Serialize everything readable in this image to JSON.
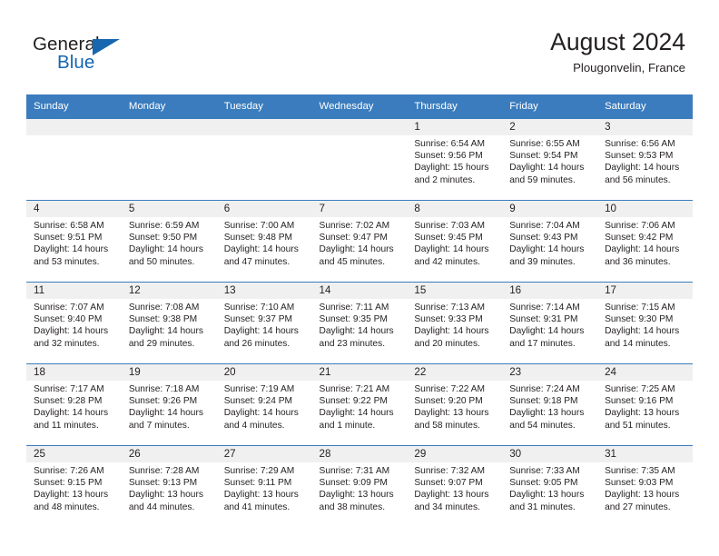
{
  "brand": {
    "name_top": "General",
    "name_bottom": "Blue",
    "triangle_color": "#1666b0",
    "text_color": "#231f20"
  },
  "header": {
    "title": "August 2024",
    "location": "Plougonvelin, France"
  },
  "theme": {
    "header_blue": "#3a7cbe",
    "daynum_strip": "#f0f0f0",
    "text": "#231f20"
  },
  "weekdays": [
    "Sunday",
    "Monday",
    "Tuesday",
    "Wednesday",
    "Thursday",
    "Friday",
    "Saturday"
  ],
  "weeks": [
    [
      {
        "day": ""
      },
      {
        "day": ""
      },
      {
        "day": ""
      },
      {
        "day": ""
      },
      {
        "day": "1",
        "sunrise": "Sunrise: 6:54 AM",
        "sunset": "Sunset: 9:56 PM",
        "daylight_1": "Daylight: 15 hours",
        "daylight_2": "and 2 minutes."
      },
      {
        "day": "2",
        "sunrise": "Sunrise: 6:55 AM",
        "sunset": "Sunset: 9:54 PM",
        "daylight_1": "Daylight: 14 hours",
        "daylight_2": "and 59 minutes."
      },
      {
        "day": "3",
        "sunrise": "Sunrise: 6:56 AM",
        "sunset": "Sunset: 9:53 PM",
        "daylight_1": "Daylight: 14 hours",
        "daylight_2": "and 56 minutes."
      }
    ],
    [
      {
        "day": "4",
        "sunrise": "Sunrise: 6:58 AM",
        "sunset": "Sunset: 9:51 PM",
        "daylight_1": "Daylight: 14 hours",
        "daylight_2": "and 53 minutes."
      },
      {
        "day": "5",
        "sunrise": "Sunrise: 6:59 AM",
        "sunset": "Sunset: 9:50 PM",
        "daylight_1": "Daylight: 14 hours",
        "daylight_2": "and 50 minutes."
      },
      {
        "day": "6",
        "sunrise": "Sunrise: 7:00 AM",
        "sunset": "Sunset: 9:48 PM",
        "daylight_1": "Daylight: 14 hours",
        "daylight_2": "and 47 minutes."
      },
      {
        "day": "7",
        "sunrise": "Sunrise: 7:02 AM",
        "sunset": "Sunset: 9:47 PM",
        "daylight_1": "Daylight: 14 hours",
        "daylight_2": "and 45 minutes."
      },
      {
        "day": "8",
        "sunrise": "Sunrise: 7:03 AM",
        "sunset": "Sunset: 9:45 PM",
        "daylight_1": "Daylight: 14 hours",
        "daylight_2": "and 42 minutes."
      },
      {
        "day": "9",
        "sunrise": "Sunrise: 7:04 AM",
        "sunset": "Sunset: 9:43 PM",
        "daylight_1": "Daylight: 14 hours",
        "daylight_2": "and 39 minutes."
      },
      {
        "day": "10",
        "sunrise": "Sunrise: 7:06 AM",
        "sunset": "Sunset: 9:42 PM",
        "daylight_1": "Daylight: 14 hours",
        "daylight_2": "and 36 minutes."
      }
    ],
    [
      {
        "day": "11",
        "sunrise": "Sunrise: 7:07 AM",
        "sunset": "Sunset: 9:40 PM",
        "daylight_1": "Daylight: 14 hours",
        "daylight_2": "and 32 minutes."
      },
      {
        "day": "12",
        "sunrise": "Sunrise: 7:08 AM",
        "sunset": "Sunset: 9:38 PM",
        "daylight_1": "Daylight: 14 hours",
        "daylight_2": "and 29 minutes."
      },
      {
        "day": "13",
        "sunrise": "Sunrise: 7:10 AM",
        "sunset": "Sunset: 9:37 PM",
        "daylight_1": "Daylight: 14 hours",
        "daylight_2": "and 26 minutes."
      },
      {
        "day": "14",
        "sunrise": "Sunrise: 7:11 AM",
        "sunset": "Sunset: 9:35 PM",
        "daylight_1": "Daylight: 14 hours",
        "daylight_2": "and 23 minutes."
      },
      {
        "day": "15",
        "sunrise": "Sunrise: 7:13 AM",
        "sunset": "Sunset: 9:33 PM",
        "daylight_1": "Daylight: 14 hours",
        "daylight_2": "and 20 minutes."
      },
      {
        "day": "16",
        "sunrise": "Sunrise: 7:14 AM",
        "sunset": "Sunset: 9:31 PM",
        "daylight_1": "Daylight: 14 hours",
        "daylight_2": "and 17 minutes."
      },
      {
        "day": "17",
        "sunrise": "Sunrise: 7:15 AM",
        "sunset": "Sunset: 9:30 PM",
        "daylight_1": "Daylight: 14 hours",
        "daylight_2": "and 14 minutes."
      }
    ],
    [
      {
        "day": "18",
        "sunrise": "Sunrise: 7:17 AM",
        "sunset": "Sunset: 9:28 PM",
        "daylight_1": "Daylight: 14 hours",
        "daylight_2": "and 11 minutes."
      },
      {
        "day": "19",
        "sunrise": "Sunrise: 7:18 AM",
        "sunset": "Sunset: 9:26 PM",
        "daylight_1": "Daylight: 14 hours",
        "daylight_2": "and 7 minutes."
      },
      {
        "day": "20",
        "sunrise": "Sunrise: 7:19 AM",
        "sunset": "Sunset: 9:24 PM",
        "daylight_1": "Daylight: 14 hours",
        "daylight_2": "and 4 minutes."
      },
      {
        "day": "21",
        "sunrise": "Sunrise: 7:21 AM",
        "sunset": "Sunset: 9:22 PM",
        "daylight_1": "Daylight: 14 hours",
        "daylight_2": "and 1 minute."
      },
      {
        "day": "22",
        "sunrise": "Sunrise: 7:22 AM",
        "sunset": "Sunset: 9:20 PM",
        "daylight_1": "Daylight: 13 hours",
        "daylight_2": "and 58 minutes."
      },
      {
        "day": "23",
        "sunrise": "Sunrise: 7:24 AM",
        "sunset": "Sunset: 9:18 PM",
        "daylight_1": "Daylight: 13 hours",
        "daylight_2": "and 54 minutes."
      },
      {
        "day": "24",
        "sunrise": "Sunrise: 7:25 AM",
        "sunset": "Sunset: 9:16 PM",
        "daylight_1": "Daylight: 13 hours",
        "daylight_2": "and 51 minutes."
      }
    ],
    [
      {
        "day": "25",
        "sunrise": "Sunrise: 7:26 AM",
        "sunset": "Sunset: 9:15 PM",
        "daylight_1": "Daylight: 13 hours",
        "daylight_2": "and 48 minutes."
      },
      {
        "day": "26",
        "sunrise": "Sunrise: 7:28 AM",
        "sunset": "Sunset: 9:13 PM",
        "daylight_1": "Daylight: 13 hours",
        "daylight_2": "and 44 minutes."
      },
      {
        "day": "27",
        "sunrise": "Sunrise: 7:29 AM",
        "sunset": "Sunset: 9:11 PM",
        "daylight_1": "Daylight: 13 hours",
        "daylight_2": "and 41 minutes."
      },
      {
        "day": "28",
        "sunrise": "Sunrise: 7:31 AM",
        "sunset": "Sunset: 9:09 PM",
        "daylight_1": "Daylight: 13 hours",
        "daylight_2": "and 38 minutes."
      },
      {
        "day": "29",
        "sunrise": "Sunrise: 7:32 AM",
        "sunset": "Sunset: 9:07 PM",
        "daylight_1": "Daylight: 13 hours",
        "daylight_2": "and 34 minutes."
      },
      {
        "day": "30",
        "sunrise": "Sunrise: 7:33 AM",
        "sunset": "Sunset: 9:05 PM",
        "daylight_1": "Daylight: 13 hours",
        "daylight_2": "and 31 minutes."
      },
      {
        "day": "31",
        "sunrise": "Sunrise: 7:35 AM",
        "sunset": "Sunset: 9:03 PM",
        "daylight_1": "Daylight: 13 hours",
        "daylight_2": "and 27 minutes."
      }
    ]
  ]
}
